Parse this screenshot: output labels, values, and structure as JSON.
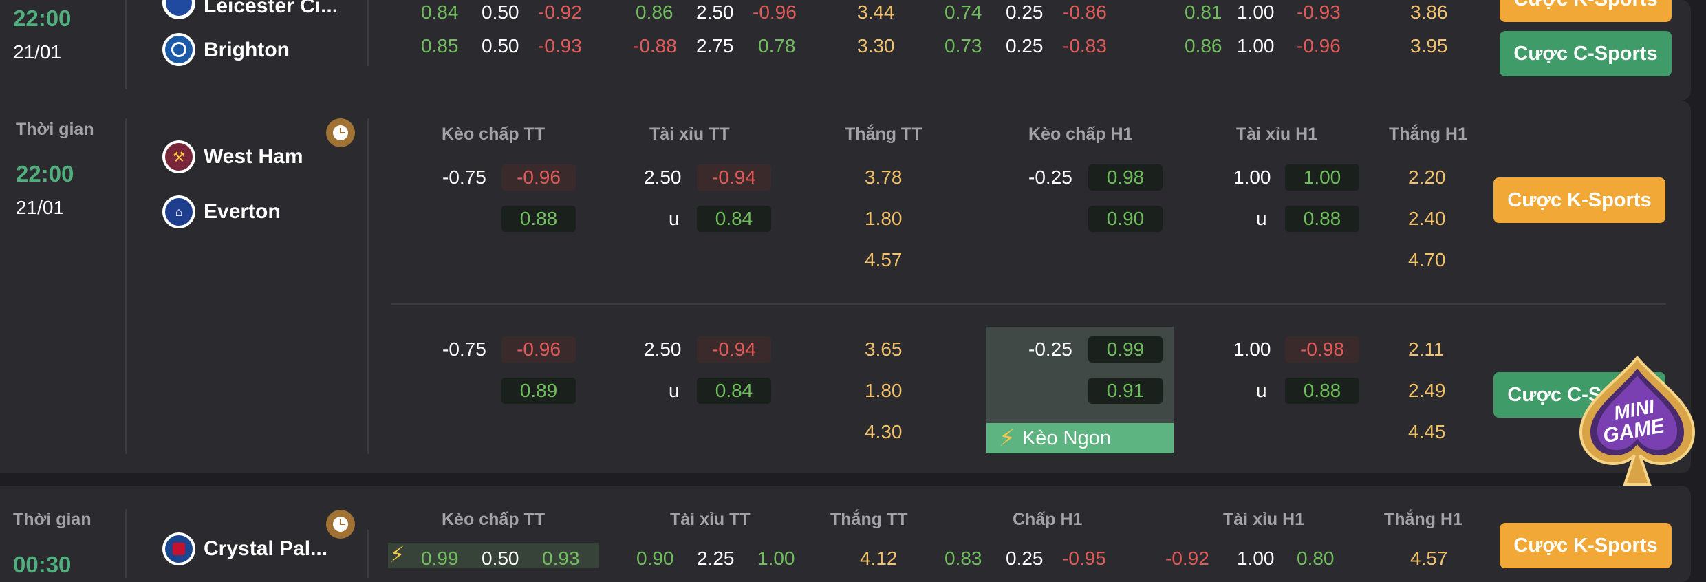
{
  "colors": {
    "green": "#6fbd5c",
    "red": "#e15a58",
    "gold": "#f2c26b",
    "k_button": "#f1a836",
    "c_button": "#3f9b67",
    "time": "#4fb07e"
  },
  "match1": {
    "time": "22:00",
    "date": "21/01",
    "team_home": "Leicester Ci...",
    "team_away": "Brighton",
    "row1": {
      "a": "0.84",
      "b": "0.50",
      "c": "-0.92",
      "d": "0.86",
      "e": "2.50",
      "f": "-0.96",
      "g": "3.44",
      "h": "0.74",
      "i": "0.25",
      "j": "-0.86",
      "k": "0.81",
      "l": "1.00",
      "m": "-0.93",
      "n": "3.86"
    },
    "row2": {
      "a": "0.85",
      "b": "0.50",
      "c": "-0.93",
      "d": "-0.88",
      "e": "2.75",
      "f": "0.78",
      "g": "3.30",
      "h": "0.73",
      "i": "0.25",
      "j": "-0.83",
      "k": "0.86",
      "l": "1.00",
      "m": "-0.96",
      "n": "3.95"
    },
    "btn_k": "Cược K-Sports",
    "btn_c": "Cược C-Sports"
  },
  "match2": {
    "time_label": "Thời gian",
    "time": "22:00",
    "date": "21/01",
    "team_home": "West Ham",
    "team_away": "Everton",
    "headers": [
      "Kèo chấp TT",
      "Tài xỉu TT",
      "Thắng TT",
      "Kèo chấp H1",
      "Tài xỉu H1",
      "Thắng H1"
    ],
    "block1": {
      "hcap": "-0.75",
      "hcap_home": "-0.96",
      "hcap_away": "0.88",
      "ou": "2.50",
      "ou_over": "-0.94",
      "ou_u": "u",
      "ou_under": "0.84",
      "win": [
        "3.78",
        "1.80",
        "4.57"
      ],
      "h1cap": "-0.25",
      "h1cap_home": "0.98",
      "h1cap_away": "0.90",
      "h1ou": "1.00",
      "h1ou_over": "1.00",
      "h1ou_u": "u",
      "h1ou_under": "0.88",
      "h1win": [
        "2.20",
        "2.40",
        "4.70"
      ]
    },
    "block2": {
      "hcap": "-0.75",
      "hcap_home": "-0.96",
      "hcap_away": "0.89",
      "ou": "2.50",
      "ou_over": "-0.94",
      "ou_u": "u",
      "ou_under": "0.84",
      "win": [
        "3.65",
        "1.80",
        "4.30"
      ],
      "h1cap": "-0.25",
      "h1cap_home": "0.99",
      "h1cap_away": "0.91",
      "h1ou": "1.00",
      "h1ou_over": "-0.98",
      "h1ou_u": "u",
      "h1ou_under": "0.88",
      "h1win": [
        "2.11",
        "2.49",
        "4.45"
      ],
      "badge": "Kèo Ngon"
    },
    "btn_k": "Cược K-Sports",
    "btn_c": "Cược C-Sports"
  },
  "match3": {
    "time_label": "Thời gian",
    "time": "00:30",
    "team_home": "Crystal Pal...",
    "headers": [
      "Kèo chấp TT",
      "Tài xỉu TT",
      "Thắng TT",
      "Chấp H1",
      "Tài xỉu H1",
      "Thắng H1"
    ],
    "row1": {
      "a": "0.99",
      "b": "0.50",
      "c": "0.93",
      "d": "0.90",
      "e": "2.25",
      "f": "1.00",
      "g": "4.12",
      "h": "0.83",
      "i": "0.25",
      "j": "-0.95",
      "k": "-0.92",
      "l": "1.00",
      "m": "0.80",
      "n": "4.57"
    },
    "btn_k": "Cược K-Sports"
  },
  "badge": {
    "line1": "MINI",
    "line2": "GAME"
  }
}
